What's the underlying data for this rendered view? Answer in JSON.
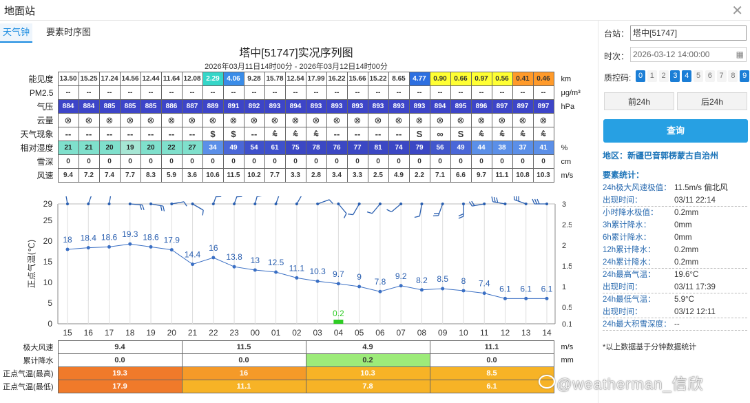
{
  "window": {
    "title": "地面站"
  },
  "tabs": [
    "天气钟",
    "要素时序图"
  ],
  "chart": {
    "title": "塔中[51747]实况序列图",
    "subtitle": "2026年03月11日14时00分 - 2026年03月12日14时00分"
  },
  "grid": {
    "labels": [
      "能见度",
      "PM2.5",
      "气压",
      "云量",
      "天气现象",
      "相对湿度",
      "雪深",
      "风速"
    ],
    "units": [
      "km",
      "μg/m³",
      "hPa",
      "",
      "",
      "%",
      "cm",
      "m/s"
    ],
    "visibility": [
      "13.50",
      "15.25",
      "17.24",
      "14.56",
      "12.44",
      "11.64",
      "12.08",
      "2.29",
      "4.06",
      "9.28",
      "15.78",
      "12.54",
      "17.99",
      "16.22",
      "15.66",
      "15.22",
      "8.65",
      "4.77",
      "0.90",
      "0.66",
      "0.97",
      "0.56",
      "0.41",
      "0.46"
    ],
    "visibility_colors": [
      "#ffffff",
      "#ffffff",
      "#ffffff",
      "#ffffff",
      "#ffffff",
      "#ffffff",
      "#ffffff",
      "#35d6c8",
      "#3a8ce8",
      "#ffffff",
      "#ffffff",
      "#ffffff",
      "#ffffff",
      "#ffffff",
      "#ffffff",
      "#ffffff",
      "#ffffff",
      "#2d6fe0",
      "#ffff33",
      "#ffff33",
      "#ffff33",
      "#ffff33",
      "#ff9a2a",
      "#ff9a2a"
    ],
    "pm25": [
      "--",
      "--",
      "--",
      "--",
      "--",
      "--",
      "--",
      "--",
      "--",
      "--",
      "--",
      "--",
      "--",
      "--",
      "--",
      "--",
      "--",
      "--",
      "--",
      "--",
      "--",
      "--",
      "--",
      "--"
    ],
    "pressure": [
      "884",
      "884",
      "885",
      "885",
      "885",
      "886",
      "887",
      "889",
      "891",
      "892",
      "893",
      "894",
      "893",
      "893",
      "893",
      "893",
      "893",
      "893",
      "894",
      "895",
      "896",
      "897",
      "897",
      "897"
    ],
    "pressure_color": "#3d45c8",
    "cloud": [
      "⊗",
      "⊗",
      "⊗",
      "⊗",
      "⊗",
      "⊗",
      "⊗",
      "⊗",
      "⊗",
      "⊗",
      "⊗",
      "⊗",
      "⊗",
      "⊗",
      "⊗",
      "⊗",
      "⊗",
      "⊗",
      "⊗",
      "⊗",
      "⊗",
      "⊗",
      "⊗",
      "⊗"
    ],
    "weather": [
      "--",
      "--",
      "--",
      "--",
      "--",
      "--",
      "--",
      "$",
      "$",
      "--",
      "⩯",
      "⩯",
      "⩯",
      "--",
      "--",
      "--",
      "--",
      "S",
      "∞",
      "S",
      "⩯",
      "⩯",
      "⩯",
      "⩯"
    ],
    "humidity": [
      "21",
      "21",
      "20",
      "19",
      "20",
      "22",
      "27",
      "34",
      "49",
      "54",
      "61",
      "75",
      "78",
      "76",
      "77",
      "81",
      "74",
      "79",
      "56",
      "49",
      "44",
      "38",
      "37",
      "41"
    ],
    "humidity_colors": [
      "#7fe0cc",
      "#7fe0cc",
      "#7fe0cc",
      "#a6e6d4",
      "#7fe0cc",
      "#7fe0cc",
      "#7fe0cc",
      "#5b8fe8",
      "#4a67d8",
      "#3f51cc",
      "#3f51cc",
      "#3b47c4",
      "#3b47c4",
      "#3b47c4",
      "#3b47c4",
      "#3b47c4",
      "#3b47c4",
      "#3b47c4",
      "#4257cc",
      "#4a67d8",
      "#5b8fe8",
      "#5b8fe8",
      "#5b8fe8",
      "#5b8fe8"
    ],
    "snow": [
      "0",
      "0",
      "0",
      "0",
      "0",
      "0",
      "0",
      "0",
      "0",
      "0",
      "0",
      "0",
      "0",
      "0",
      "0",
      "0",
      "0",
      "0",
      "0",
      "0",
      "0",
      "0",
      "0",
      "0"
    ],
    "wind": [
      "9.4",
      "7.2",
      "7.4",
      "7.7",
      "8.3",
      "5.9",
      "3.6",
      "10.6",
      "11.5",
      "10.2",
      "7.7",
      "3.3",
      "2.8",
      "3.4",
      "3.3",
      "2.5",
      "4.9",
      "2.2",
      "7.1",
      "6.6",
      "9.7",
      "11.1",
      "10.8",
      "10.3"
    ]
  },
  "chart_data": {
    "type": "line",
    "x": [
      "15",
      "16",
      "17",
      "18",
      "19",
      "20",
      "21",
      "22",
      "23",
      "00",
      "01",
      "02",
      "03",
      "04",
      "05",
      "06",
      "07",
      "08",
      "09",
      "10",
      "11",
      "12",
      "13",
      "14"
    ],
    "series": [
      {
        "name": "",
        "axis": "left",
        "values": [
          18,
          18.4,
          18.6,
          19.3,
          18.6,
          17.9,
          14.4,
          16,
          13.8,
          13,
          12.5,
          11.1,
          10.3,
          9.7,
          9,
          7.8,
          9.2,
          8.2,
          8.5,
          8,
          7.4,
          6.1,
          6.1,
          6.1
        ]
      },
      {
        "name": "",
        "type": "bar",
        "axis": "right",
        "values": [
          0,
          0,
          0,
          0,
          0,
          0,
          0,
          0,
          0,
          0,
          0,
          0,
          0,
          0.2,
          0,
          0,
          0,
          0,
          0,
          0,
          0,
          0,
          0,
          0
        ]
      }
    ],
    "ylabel": "正点气温(℃)",
    "y2label": "小时降水量(mm)",
    "ylim": [
      0,
      29
    ],
    "yticks": [
      "0",
      "5",
      "10",
      "15",
      "20",
      "25",
      "29"
    ],
    "y2lim": [
      0.1,
      3
    ],
    "y2ticks": [
      "0.1",
      "0.5",
      "1",
      "1.5",
      "2",
      "2.5",
      "3"
    ],
    "precip_label": "0.2",
    "wind_barbs_dir_deg": [
      350,
      20,
      10,
      95,
      100,
      80,
      120,
      20,
      20,
      15,
      20,
      30,
      70,
      140,
      210,
      220,
      230,
      190,
      200,
      180,
      260,
      280,
      290,
      270
    ],
    "grid": true
  },
  "bottom": {
    "rows": [
      {
        "label": "极大风速",
        "unit": "m/s",
        "values": [
          "9.4",
          "11.5",
          "4.9",
          "11.1"
        ],
        "colors": [
          "#ffffff",
          "#ffffff",
          "#ffffff",
          "#ffffff"
        ]
      },
      {
        "label": "累计降水",
        "unit": "mm",
        "values": [
          "0.0",
          "0.0",
          "0.2",
          "0.0"
        ],
        "colors": [
          "#ffffff",
          "#ffffff",
          "#9deb7a",
          "#ffffff"
        ]
      },
      {
        "label": "正点气温(最高)",
        "unit": "",
        "values": [
          "19.3",
          "16",
          "10.3",
          "8.5"
        ],
        "colors": [
          "#f07a2a",
          "#f59a28",
          "#f7b326",
          "#f7b326"
        ]
      },
      {
        "label": "正点气温(最低)",
        "unit": "",
        "values": [
          "17.9",
          "11.1",
          "7.8",
          "6.1"
        ],
        "colors": [
          "#f07a2a",
          "#f7b326",
          "#f7b326",
          "#f7b326"
        ]
      }
    ]
  },
  "side": {
    "station_label": "台站：",
    "station_value": "塔中[51747]",
    "time_label": "时次：",
    "time_value": "2026-03-12 14:00:00",
    "qc_label": "质控码:",
    "qc_codes": [
      "0",
      "1",
      "2",
      "3",
      "4",
      "5",
      "6",
      "7",
      "8",
      "9"
    ],
    "qc_selected": [
      "0",
      "3",
      "4",
      "9"
    ],
    "prev_btn": "前24h",
    "next_btn": "后24h",
    "query_btn": "查询",
    "region": "地区：新疆巴音郭楞蒙古自治州",
    "stats_heading": "要素统计：",
    "stats": [
      {
        "k": "24h极大风速极值：",
        "v": "11.5m/s 偏北风"
      },
      {
        "k": "出现时间：",
        "v": "03/11 22:14"
      },
      {
        "k": "小时降水极值：",
        "v": "0.2mm"
      },
      {
        "k": "3h累计降水：",
        "v": "0mm"
      },
      {
        "k": "6h累计降水：",
        "v": "0mm"
      },
      {
        "k": "12h累计降水：",
        "v": "0.2mm"
      },
      {
        "k": "24h累计降水：",
        "v": "0.2mm"
      },
      {
        "k": "24h最高气温：",
        "v": "19.6°C"
      },
      {
        "k": "出现时间：",
        "v": "03/11 17:39"
      },
      {
        "k": "24h最低气温：",
        "v": "5.9°C"
      },
      {
        "k": "出现时间：",
        "v": "03/12 12:11"
      },
      {
        "k": "24h最大积雪深度：",
        "v": "--"
      }
    ],
    "note": "*以上数据基于分钟数据统计"
  },
  "watermark": "@weatherman_信欣"
}
